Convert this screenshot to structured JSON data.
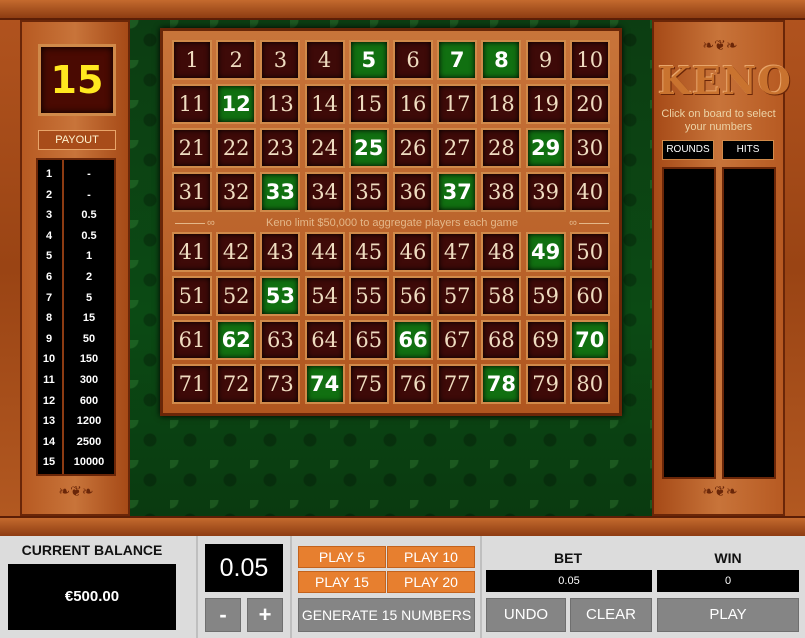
{
  "selected_count": "15",
  "payout": {
    "label": "PAYOUT",
    "rows": [
      {
        "hits": "1",
        "pay": "-"
      },
      {
        "hits": "2",
        "pay": "-"
      },
      {
        "hits": "3",
        "pay": "0.5"
      },
      {
        "hits": "4",
        "pay": "0.5"
      },
      {
        "hits": "5",
        "pay": "1"
      },
      {
        "hits": "6",
        "pay": "2"
      },
      {
        "hits": "7",
        "pay": "5"
      },
      {
        "hits": "8",
        "pay": "15"
      },
      {
        "hits": "9",
        "pay": "50"
      },
      {
        "hits": "10",
        "pay": "150"
      },
      {
        "hits": "11",
        "pay": "300"
      },
      {
        "hits": "12",
        "pay": "600"
      },
      {
        "hits": "13",
        "pay": "1200"
      },
      {
        "hits": "14",
        "pay": "2500"
      },
      {
        "hits": "15",
        "pay": "10000"
      }
    ]
  },
  "board": {
    "selected_numbers": [
      5,
      7,
      8,
      12,
      25,
      29,
      33,
      37,
      49,
      53,
      62,
      66,
      70,
      74,
      78
    ],
    "limit_text": "Keno limit $50,000 to aggregate players each game"
  },
  "right_panel": {
    "logo": "KENO",
    "instruction": "Click on board to select your numbers",
    "rounds_label": "ROUNDS",
    "hits_label": "HITS"
  },
  "bottom": {
    "balance_label": "CURRENT BALANCE",
    "balance_value": "€500.00",
    "bet_amount": "0.05",
    "minus_label": "-",
    "plus_label": "+",
    "play5": "PLAY 5",
    "play10": "PLAY 10",
    "play15": "PLAY 15",
    "play20": "PLAY 20",
    "generate_label": "GENERATE 15 NUMBERS",
    "bet_label": "BET",
    "bet_value": "0.05",
    "win_label": "WIN",
    "win_value": "0",
    "undo_label": "UNDO",
    "clear_label": "CLEAR",
    "play_label": "PLAY"
  },
  "colors": {
    "selected_cell": "#117011",
    "unselected_cell": "#3e0a08",
    "count_text": "#ffe81f",
    "orange_button": "#e77f2f",
    "grey_button": "#858585"
  }
}
